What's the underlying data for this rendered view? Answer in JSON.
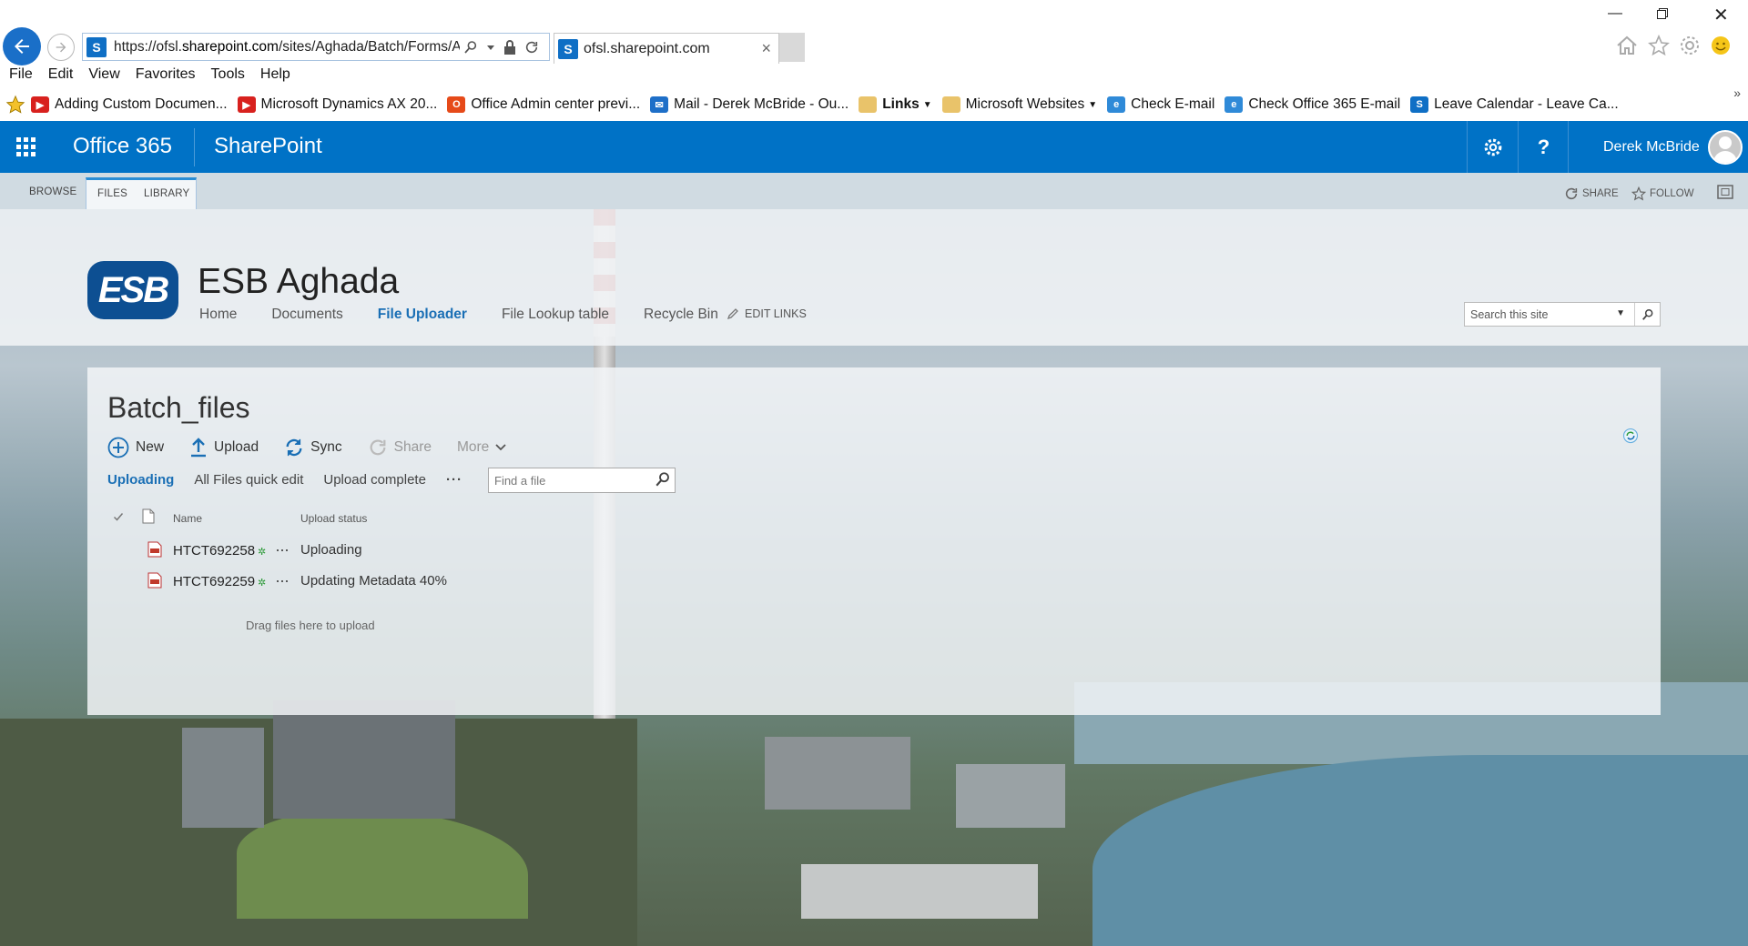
{
  "browser": {
    "url_prefix": "https://ofsl.",
    "url_domain": "sharepoint.com",
    "url_rest": "/sites/Aghada/Batch/Forms/Al",
    "tab_title": "ofsl.sharepoint.com",
    "menu": [
      "File",
      "Edit",
      "View",
      "Favorites",
      "Tools",
      "Help"
    ],
    "favorites": [
      {
        "label": "Adding Custom Documen...",
        "icon": "youtube-icon"
      },
      {
        "label": "Microsoft Dynamics AX 20...",
        "icon": "youtube-icon"
      },
      {
        "label": "Office Admin center previ...",
        "icon": "office-icon"
      },
      {
        "label": "Mail - Derek McBride - Ou...",
        "icon": "mail-icon"
      },
      {
        "label": "Links",
        "icon": "folder-icon"
      },
      {
        "label": "Microsoft Websites",
        "icon": "folder-icon"
      },
      {
        "label": "Check E-mail",
        "icon": "ie-icon"
      },
      {
        "label": "Check Office 365 E-mail",
        "icon": "ie-icon"
      },
      {
        "label": "Leave Calendar - Leave Ca...",
        "icon": "sharepoint-icon"
      }
    ]
  },
  "suitebar": {
    "brand": "Office 365",
    "app": "SharePoint",
    "user": "Derek McBride",
    "color": "#0072c6"
  },
  "ribbon": {
    "tabs": [
      "BROWSE",
      "FILES",
      "LIBRARY"
    ],
    "share": "SHARE",
    "follow": "FOLLOW"
  },
  "site": {
    "logo_text": "ESB",
    "title": "ESB Aghada",
    "nav": [
      "Home",
      "Documents",
      "File Uploader",
      "File Lookup table",
      "Recycle Bin"
    ],
    "edit_links": "EDIT LINKS",
    "search_placeholder": "Search this site"
  },
  "library": {
    "title": "Batch_files",
    "commands": {
      "new": "New",
      "upload": "Upload",
      "sync": "Sync",
      "share": "Share",
      "more": "More"
    },
    "views": {
      "uploading": "Uploading",
      "quick_edit": "All Files quick edit",
      "complete": "Upload complete",
      "more": "···"
    },
    "find_placeholder": "Find a file",
    "columns": {
      "name": "Name",
      "status": "Upload status"
    },
    "rows": [
      {
        "name": "HTCT692258",
        "status": "Uploading"
      },
      {
        "name": "HTCT692259",
        "status": "Updating Metadata 40%"
      }
    ],
    "drag_text": "Drag files here to upload"
  }
}
